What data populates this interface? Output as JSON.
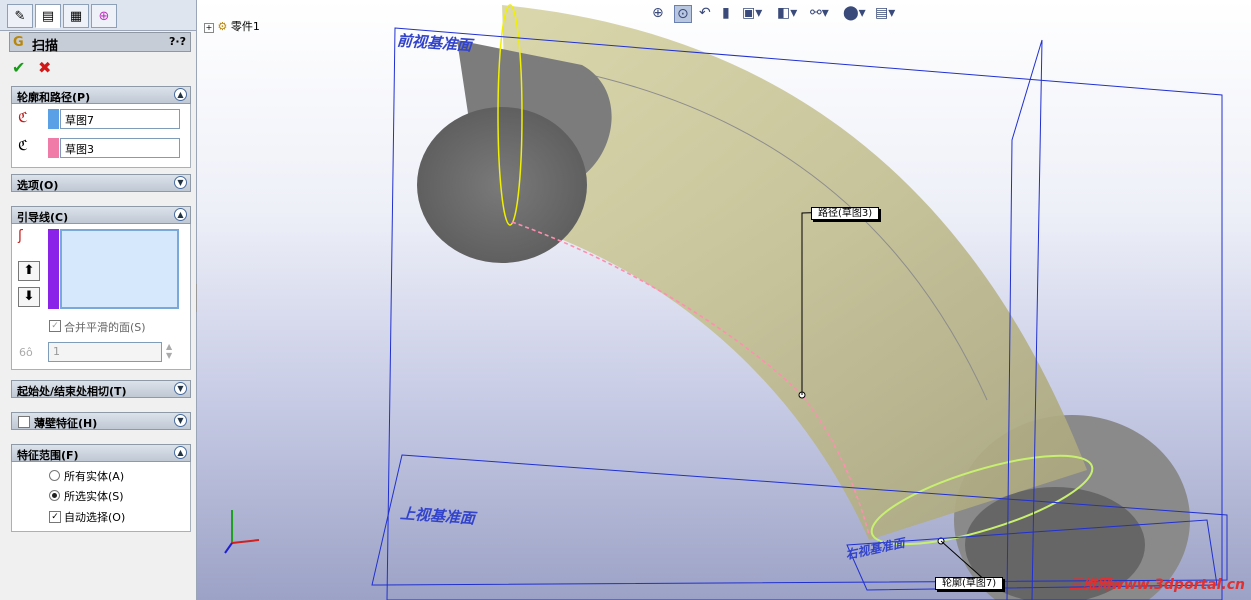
{
  "panel": {
    "title": "扫描",
    "help": "?·?",
    "ok_icon": "check-icon",
    "cancel_icon": "x-icon",
    "sections": {
      "profile_path": {
        "label": "轮廓和路径(P)",
        "profile": "草图7",
        "path": "草图3"
      },
      "options": {
        "label": "选项(O)"
      },
      "guides": {
        "label": "引导线(C)",
        "merge_smooth": "合并平滑的面(S)",
        "count": "1"
      },
      "tangency": {
        "label": "起始处/结束处相切(T)"
      },
      "thin": {
        "label": "薄壁特征(H)"
      },
      "scope": {
        "label": "特征范围(F)",
        "all_bodies": "所有实体(A)",
        "selected_bodies": "所选实体(S)",
        "auto_select": "自动选择(O)"
      }
    },
    "colors": {
      "profile_swatch": "#5aa0e6",
      "path_swatch": "#f07aa8",
      "guide_swatch": "#8a22e8"
    }
  },
  "viewport": {
    "tree_label": "零件1",
    "front_plane": "前视基准面",
    "top_plane": "上视基准面",
    "right_plane": "右视基准面",
    "path_callout": "路径(草图3)",
    "profile_callout": "轮廓(草图7)",
    "watermark": "三维网www.3dportal.cn"
  }
}
